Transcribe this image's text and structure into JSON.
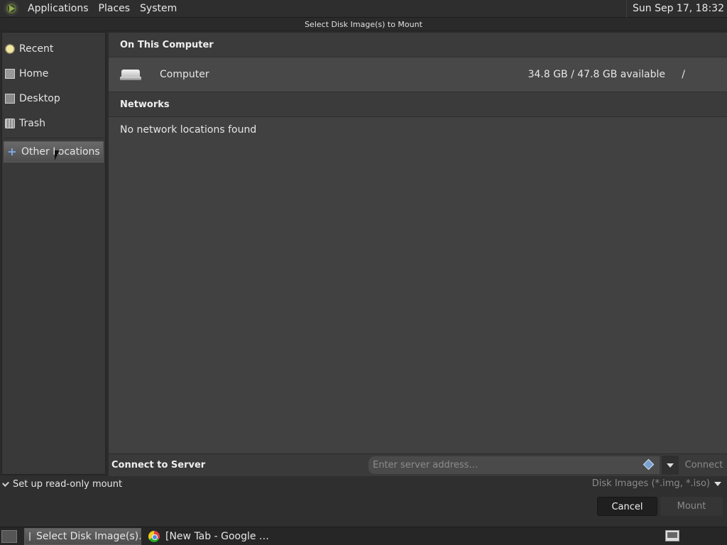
{
  "top_panel": {
    "menus": [
      "Applications",
      "Places",
      "System"
    ],
    "clock": "Sun Sep 17, 18:32"
  },
  "dialog": {
    "title": "Select Disk Image(s) to Mount"
  },
  "sidebar": {
    "items": [
      {
        "label": "Recent",
        "icon": "clock-icon"
      },
      {
        "label": "Home",
        "icon": "home-icon"
      },
      {
        "label": "Desktop",
        "icon": "desktop-icon"
      },
      {
        "label": "Trash",
        "icon": "trash-icon"
      },
      {
        "label": "Other Locations",
        "icon": "plus-icon",
        "selected": true
      }
    ]
  },
  "main": {
    "on_this_computer": {
      "heading": "On This Computer",
      "entries": [
        {
          "name": "Computer",
          "available": "34.8 GB / 47.8 GB available",
          "mount_point": "/"
        }
      ]
    },
    "networks": {
      "heading": "Networks",
      "empty_message": "No network locations found"
    }
  },
  "connect": {
    "label": "Connect to Server",
    "placeholder": "Enter server address…",
    "button": "Connect"
  },
  "footer": {
    "readonly_label": "Set up read-only mount",
    "readonly_checked": true,
    "filter": "Disk Images (*.img, *.iso)",
    "cancel": "Cancel",
    "mount": "Mount"
  },
  "taskbar": {
    "tasks": [
      {
        "label": "Select Disk Image(s)…",
        "active": true
      },
      {
        "label": "[New Tab - Google …",
        "active": false
      }
    ]
  },
  "colors": {
    "background": "#414141",
    "sidebar": "#393939",
    "panel": "#2e2e2e",
    "selection": "#5a5a5a"
  }
}
